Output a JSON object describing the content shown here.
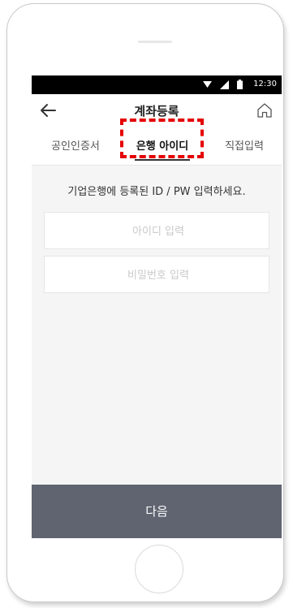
{
  "statusbar": {
    "time": "12:30"
  },
  "appbar": {
    "title": "계좌등록",
    "back_icon": "arrow-left-icon",
    "home_icon": "home-icon"
  },
  "tabs": [
    {
      "label": "공인인증서",
      "active": false
    },
    {
      "label": "은행 아이디",
      "active": true
    },
    {
      "label": "직접입력",
      "active": false
    }
  ],
  "instruction": "기업은행에 등록된 ID / PW 입력하세요.",
  "form": {
    "id_placeholder": "아이디 입력",
    "pw_placeholder": "비밀번호 입력"
  },
  "next_button_label": "다음",
  "highlight_color": "#e50000",
  "button_color": "#5f6470"
}
